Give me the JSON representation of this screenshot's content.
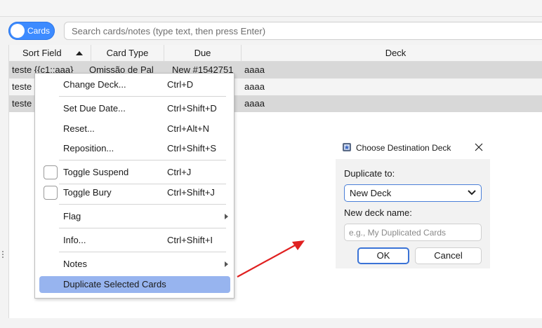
{
  "toolbar": {
    "toggle_label": "Cards",
    "search_placeholder": "Search cards/notes (type text, then press Enter)"
  },
  "table": {
    "headers": [
      "Sort Field",
      "Card Type",
      "Due",
      "Deck"
    ],
    "rows": [
      {
        "sort_field": "teste {{c1::aaa}",
        "card_type": "Omissão de Pal",
        "due": "New #1542751",
        "deck": "aaaa"
      },
      {
        "sort_field": "teste",
        "card_type": "",
        "due": "",
        "deck": "aaaa"
      },
      {
        "sort_field": "teste",
        "card_type": "",
        "due": "",
        "deck": "aaaa"
      }
    ]
  },
  "context_menu": {
    "items": [
      {
        "label": "Change Deck...",
        "shortcut": "Ctrl+D"
      },
      {
        "label": "Set Due Date...",
        "shortcut": "Ctrl+Shift+D"
      },
      {
        "label": "Reset...",
        "shortcut": "Ctrl+Alt+N"
      },
      {
        "label": "Reposition...",
        "shortcut": "Ctrl+Shift+S"
      },
      {
        "label": "Toggle Suspend",
        "shortcut": "Ctrl+J"
      },
      {
        "label": "Toggle Bury",
        "shortcut": "Ctrl+Shift+J"
      },
      {
        "label": "Flag",
        "shortcut": ""
      },
      {
        "label": "Info...",
        "shortcut": "Ctrl+Shift+I"
      },
      {
        "label": "Notes",
        "shortcut": ""
      },
      {
        "label": "Duplicate Selected Cards",
        "shortcut": ""
      }
    ],
    "highlight_color": "#97b4ef"
  },
  "dialog": {
    "title": "Choose Destination Deck",
    "duplicate_to_label": "Duplicate to:",
    "selected_option": "New Deck",
    "new_deck_name_label": "New deck name:",
    "new_deck_name_placeholder": "e.g., My Duplicated Cards",
    "new_deck_name_value": "",
    "ok_label": "OK",
    "cancel_label": "Cancel"
  },
  "colors": {
    "accent": "#3d8bff",
    "annotation_arrow": "#e02020",
    "selected_row": "#d8d8d8"
  }
}
